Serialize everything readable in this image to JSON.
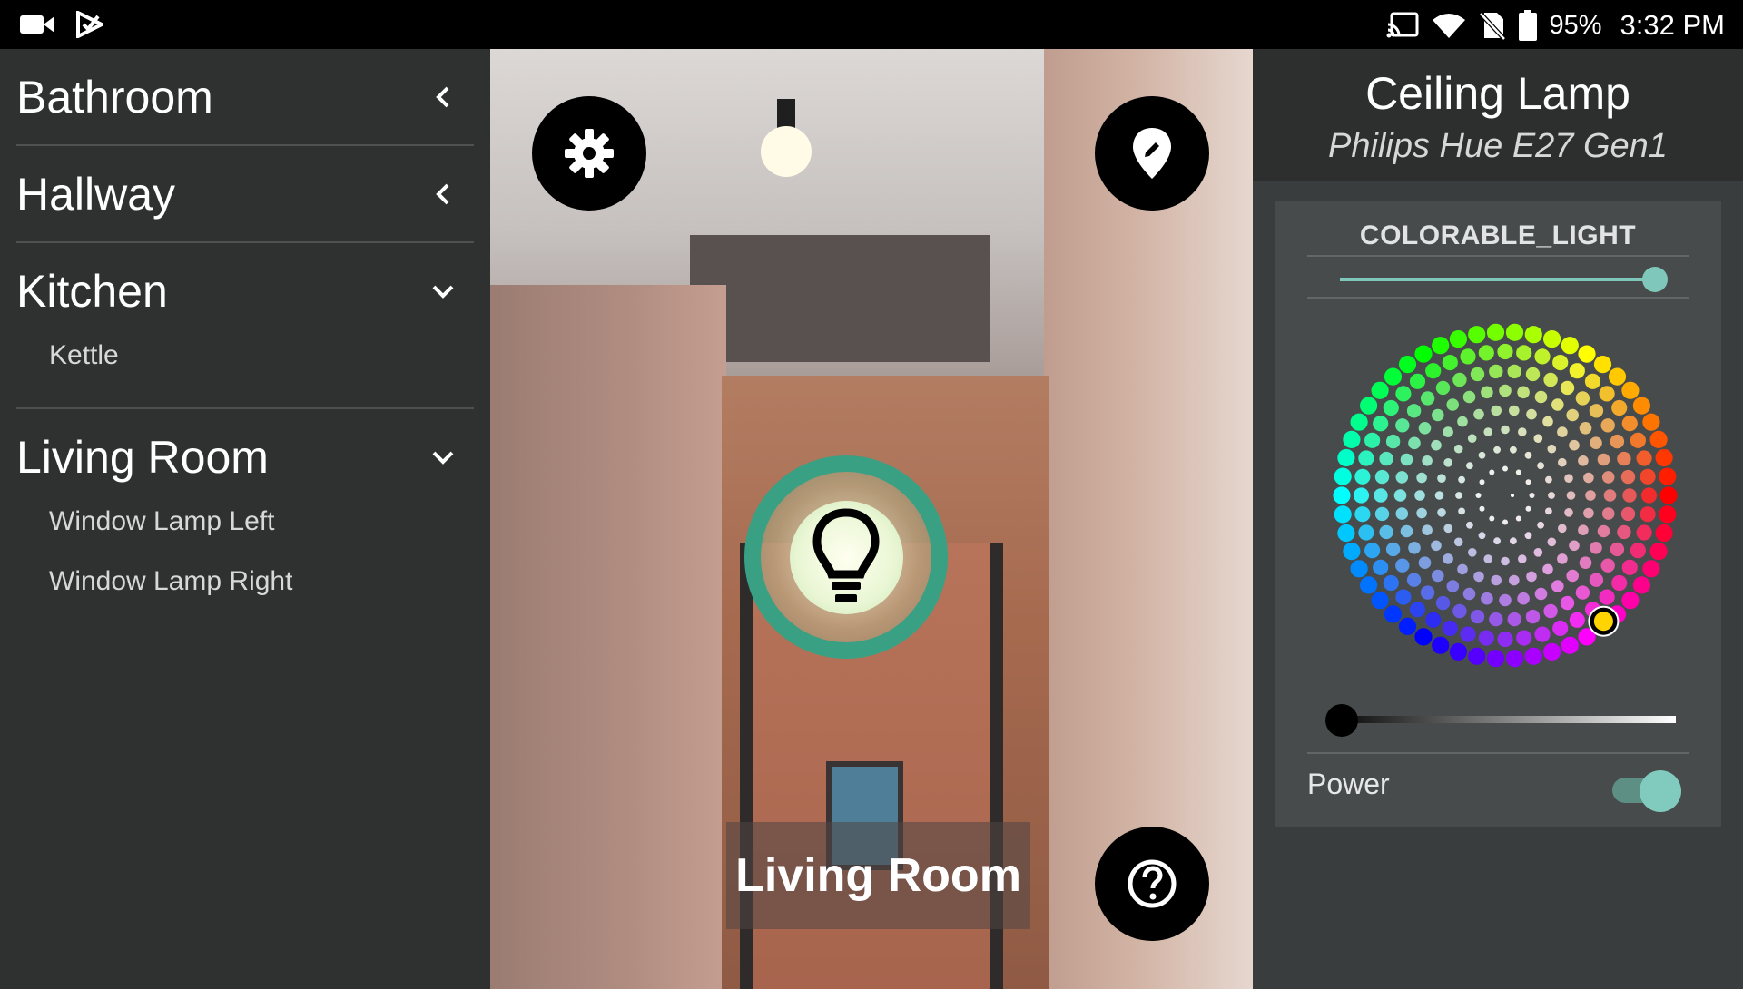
{
  "status_bar": {
    "left_icons": [
      "video-camera-icon",
      "play-store-icon"
    ],
    "right_icons": [
      "cast-icon",
      "wifi-icon",
      "sim-off-icon",
      "battery-icon"
    ],
    "battery": "95%",
    "time": "3:32 PM"
  },
  "sidebar": {
    "rooms": [
      {
        "name": "Bathroom",
        "expanded": false,
        "items": []
      },
      {
        "name": "Hallway",
        "expanded": false,
        "items": []
      },
      {
        "name": "Kitchen",
        "expanded": true,
        "items": [
          "Kettle"
        ]
      },
      {
        "name": "Living Room",
        "expanded": true,
        "items": [
          "Window Lamp Left",
          "Window Lamp Right"
        ]
      }
    ]
  },
  "camera": {
    "settings_icon": "gear-icon",
    "edit_icon": "edit-location-icon",
    "help_icon": "help-icon",
    "lamp_marker_icon": "lightbulb-icon",
    "room_label": "Living Room"
  },
  "device_panel": {
    "title": "Ceiling Lamp",
    "subtitle": "Philips Hue E27 Gen1",
    "card_title": "COLORABLE_LIGHT",
    "slider_level": 0.95,
    "selected_color": "#ffd400",
    "brightness_level": 0.0,
    "power_label": "Power",
    "power_on": true,
    "accent": "#80cbbd"
  }
}
